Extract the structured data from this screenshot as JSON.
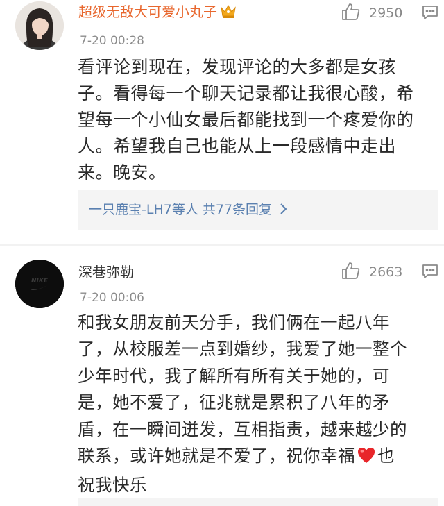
{
  "comments": [
    {
      "username": "超级无敌大可爱小丸子",
      "badge_icon": "crown-icon",
      "timestamp": "7-20 00:28",
      "like_count": "2950",
      "like_icon": "thumbs-up-icon",
      "reply_icon": "comment-icon",
      "body_lines": [
        "看评论到现在，发现评论的大多都是女孩",
        "子。看得每一个聊天记录都让我很心酸，希",
        "望每一个小仙女最后都能找到一个疼爱你的",
        "人。希望我自己也能从上一段感情中走出",
        "来。晚安。"
      ],
      "replies_summary": {
        "text": "一只鹿宝-LH7等人  共77条回复",
        "icon": "chevron-right-icon"
      }
    },
    {
      "username": "深巷弥勒",
      "timestamp": "7-20 00:06",
      "like_count": "2663",
      "like_icon": "thumbs-up-icon",
      "reply_icon": "comment-icon",
      "avatar_text": "NIKE",
      "body_lines": [
        "和我女朋友前天分手，我们俩在一起八年",
        "了，从校服差一点到婚纱，我爱了她一整个",
        "少年时代，我了解所有所有关于她的，可",
        "是，她不爱了，征兆就是累积了八年的矛",
        "盾，在一瞬间迸发，互相指责，越来越少的"
      ],
      "body_line6_before": "联系，或许她就是不爱了，祝你幸福",
      "body_line6_emoji": "heart-icon",
      "body_line6_after": "也",
      "body_line7": "祝我快乐"
    }
  ],
  "colors": {
    "highlight_username": "#e8672e",
    "link_blue": "#5a80b0",
    "heart_red": "#e8262a",
    "crown_gold": "#f2a81d"
  }
}
